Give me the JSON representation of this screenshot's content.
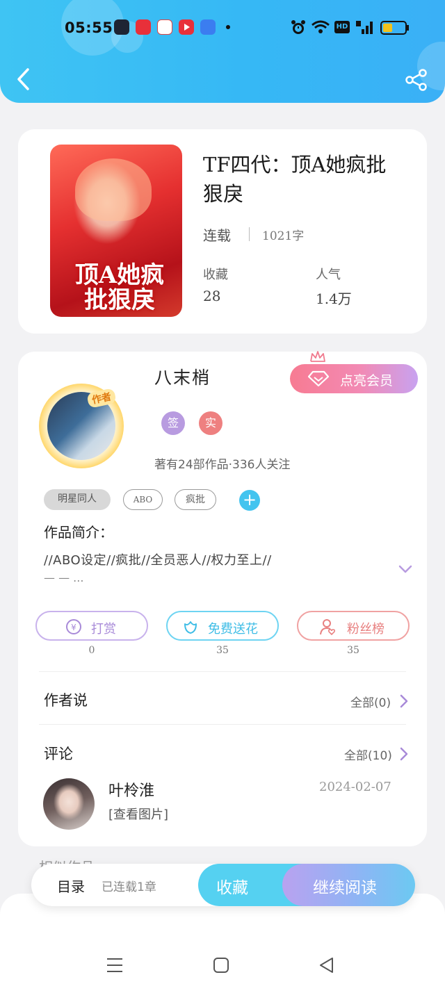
{
  "status_bar": {
    "time": "05:55"
  },
  "book": {
    "title": "TF四代：顶A她疯批狠戾",
    "cover_text": "顶A她疯批狠戾",
    "status": "连载",
    "word_count": "1021字",
    "stats": [
      {
        "label": "收藏",
        "value": "28"
      },
      {
        "label": "人气",
        "value": "1.4万"
      }
    ]
  },
  "author": {
    "name": "八末梢",
    "badge": "作者",
    "vip_label": "点亮会员",
    "tags": [
      "签",
      "实"
    ],
    "works_line": "著有24部作品·336人关注"
  },
  "genre_tags": [
    "明星同人",
    "ABO",
    "疯批"
  ],
  "intro": {
    "label": "作品简介：",
    "text": "//ABO设定//疯批//全员恶人//权力至上//",
    "more": "— — ..."
  },
  "actions": [
    {
      "label": "打赏",
      "count": "0"
    },
    {
      "label": "免费送花",
      "count": "35"
    },
    {
      "label": "粉丝榜",
      "count": "35"
    }
  ],
  "author_says": {
    "title": "作者说",
    "all": "全部(0)"
  },
  "comments": {
    "title": "评论",
    "all": "全部(10)",
    "items": [
      {
        "user": "叶柃淮",
        "date": "2024-02-07",
        "text": "[查看图片]"
      }
    ]
  },
  "peek_section": "相似作品",
  "bottom_bar": {
    "toc": "目录",
    "chapters": "已连载1章",
    "collect": "收藏",
    "read": "继续阅读"
  },
  "colors": {
    "header": "#3ab8f5",
    "vip": "#f28ab4",
    "reward": "#b89be0",
    "flower": "#43c4ef",
    "fans": "#ee8a8a"
  }
}
